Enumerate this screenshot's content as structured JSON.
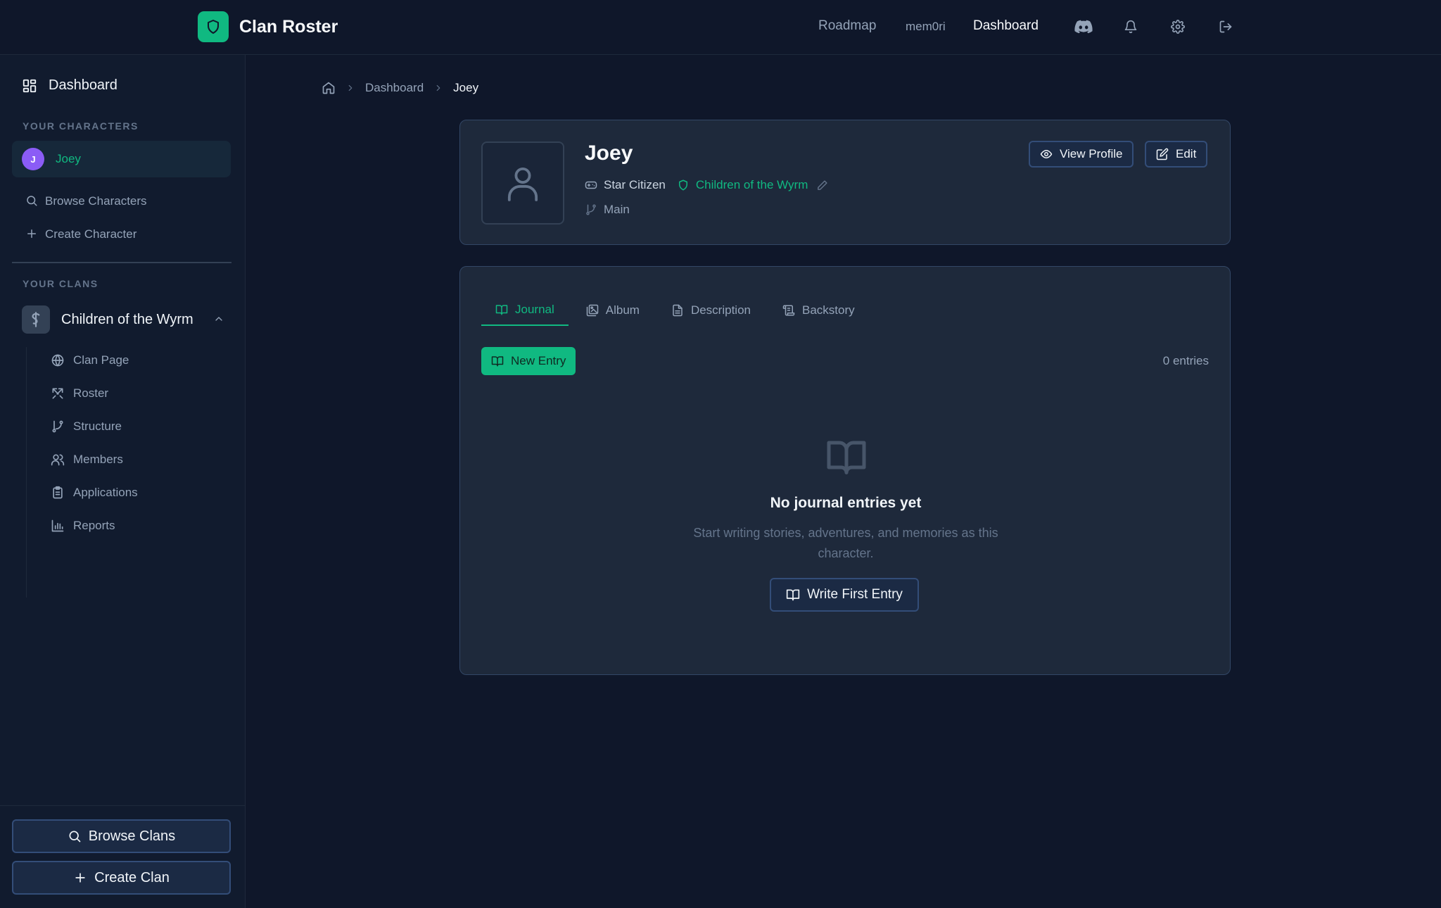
{
  "app": {
    "title": "Clan Roster"
  },
  "topnav": {
    "roadmap": "Roadmap",
    "user": "mem0ri",
    "dashboard": "Dashboard",
    "icons": [
      "discord-icon",
      "bell-icon",
      "gear-icon",
      "logout-icon"
    ]
  },
  "sidebar": {
    "dashboard": "Dashboard",
    "characters_heading": "YOUR CHARACTERS",
    "character": {
      "initial": "J",
      "name": "Joey"
    },
    "browse_characters": "Browse Characters",
    "create_character": "Create Character",
    "clans_heading": "YOUR CLANS",
    "clan": {
      "name": "Children of the Wyrm",
      "items": [
        {
          "label": "Clan Page",
          "icon": "globe-icon"
        },
        {
          "label": "Roster",
          "icon": "swords-icon"
        },
        {
          "label": "Structure",
          "icon": "branch-icon"
        },
        {
          "label": "Members",
          "icon": "users-icon"
        },
        {
          "label": "Applications",
          "icon": "clipboard-icon"
        },
        {
          "label": "Reports",
          "icon": "bar-chart-icon"
        }
      ]
    },
    "browse_clans": "Browse Clans",
    "create_clan": "Create Clan"
  },
  "breadcrumb": {
    "dashboard": "Dashboard",
    "current": "Joey"
  },
  "profile": {
    "name": "Joey",
    "game": "Star Citizen",
    "clan": "Children of the Wyrm",
    "role": "Main",
    "view_profile": "View Profile",
    "edit": "Edit"
  },
  "tabs": [
    "Journal",
    "Album",
    "Description",
    "Backstory"
  ],
  "journal": {
    "new_entry": "New Entry",
    "count": "0 entries",
    "empty_title": "No journal entries yet",
    "empty_text": "Start writing stories, adventures, and memories as this character.",
    "write_first": "Write First Entry"
  },
  "colors": {
    "background": "#0f172a",
    "accent": "#10b981",
    "card": "#1e293b",
    "avatar": "#8b5cf6"
  }
}
